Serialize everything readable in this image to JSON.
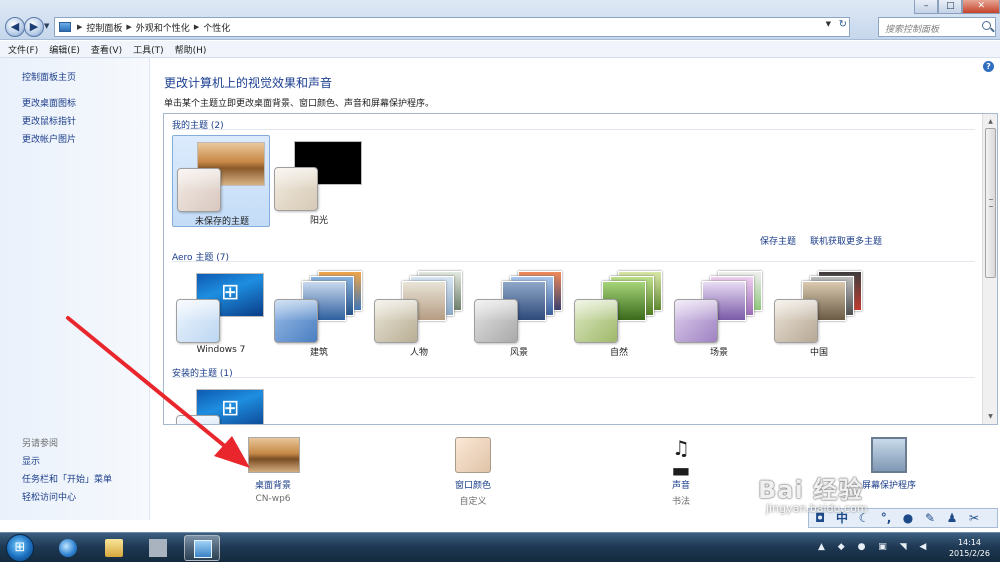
{
  "address": {
    "crumbs": [
      "控制面板",
      "外观和个性化",
      "个性化"
    ],
    "search_placeholder": "搜索控制面板"
  },
  "menu": [
    "文件(F)",
    "编辑(E)",
    "查看(V)",
    "工具(T)",
    "帮助(H)"
  ],
  "left_pane": {
    "links": [
      "控制面板主页",
      "更改桌面图标",
      "更改鼠标指针",
      "更改帐户图片"
    ],
    "see_also_heading": "另请参阅",
    "see_also": [
      "显示",
      "任务栏和「开始」菜单",
      "轻松访问中心"
    ]
  },
  "main": {
    "title": "更改计算机上的视觉效果和声音",
    "subtitle": "单击某个主题立即更改桌面背景、窗口颜色、声音和屏幕保护程序。",
    "my_themes_heading": "我的主题 (2)",
    "my_themes": [
      {
        "name": "未保存的主题",
        "selected": true
      },
      {
        "name": "阳光",
        "selected": false
      }
    ],
    "save_theme_link": "保存主题",
    "online_themes_link": "联机获取更多主题",
    "aero_heading": "Aero 主题 (7)",
    "aero_themes": [
      "Windows 7",
      "建筑",
      "人物",
      "风景",
      "自然",
      "场景",
      "中国"
    ],
    "installed_heading": "安装的主题 (1)"
  },
  "settings": [
    {
      "label": "桌面背景",
      "value": "CN-wp6",
      "icon": "desktop-background-icon"
    },
    {
      "label": "窗口颜色",
      "value": "自定义",
      "icon": "window-color-icon"
    },
    {
      "label": "声音",
      "value": "书法",
      "icon": "sound-icon"
    },
    {
      "label": "屏幕保护程序",
      "value": "",
      "icon": "screensaver-icon"
    }
  ],
  "watermark": {
    "main": "Bai 经验",
    "sub": "jingyan.baidu.com"
  },
  "taskbar": {
    "time": "14:14",
    "date": "2015/2/26"
  },
  "langbar": [
    "中"
  ],
  "colors": {
    "accent": "#1b3d89",
    "selection": "#c3dcf7",
    "arrow": "#e8262c"
  }
}
